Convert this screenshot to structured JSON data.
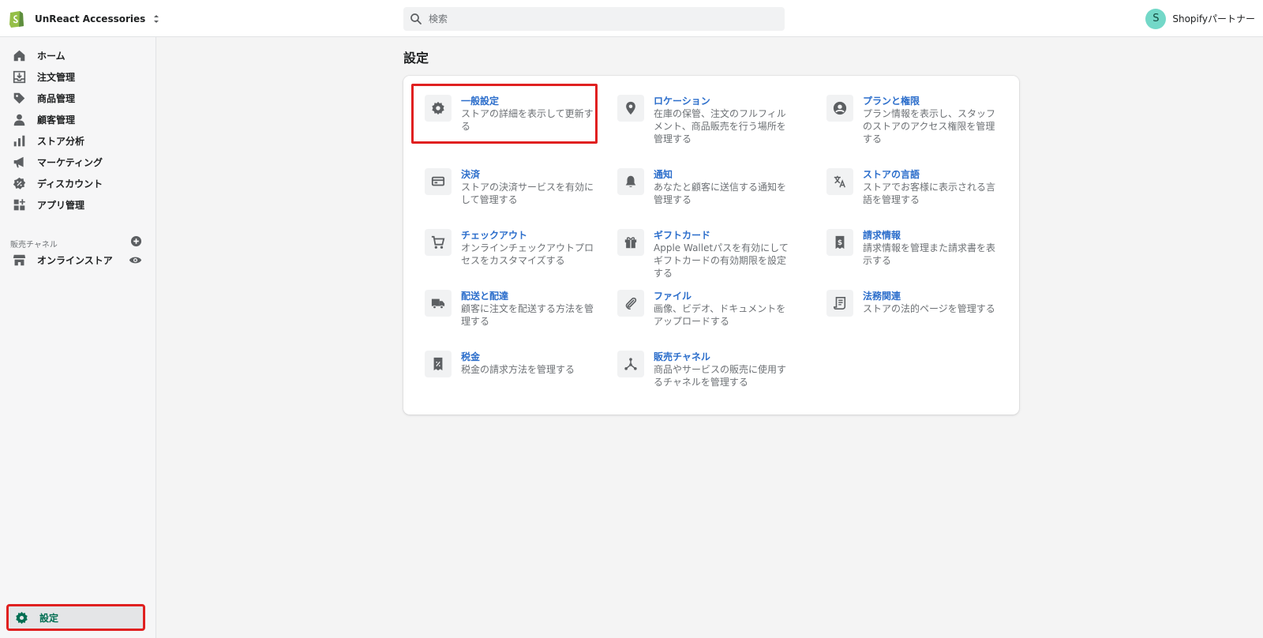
{
  "header": {
    "store_name": "UnReact Accessories",
    "search_placeholder": "検索",
    "user_initial": "S",
    "user_name": "Shopifyパートナー"
  },
  "sidebar": {
    "items": [
      {
        "label": "ホーム",
        "icon": "home-icon"
      },
      {
        "label": "注文管理",
        "icon": "orders-icon"
      },
      {
        "label": "商品管理",
        "icon": "tag-icon"
      },
      {
        "label": "顧客管理",
        "icon": "person-icon"
      },
      {
        "label": "ストア分析",
        "icon": "analytics-icon"
      },
      {
        "label": "マーケティング",
        "icon": "megaphone-icon"
      },
      {
        "label": "ディスカウント",
        "icon": "discount-icon"
      },
      {
        "label": "アプリ管理",
        "icon": "apps-icon"
      }
    ],
    "sales_channels_title": "販売チャネル",
    "online_store": "オンラインストア",
    "settings": "設定"
  },
  "main": {
    "title": "設定",
    "tiles": [
      {
        "title": "一般設定",
        "desc": "ストアの詳細を表示して更新する",
        "icon": "gear-icon"
      },
      {
        "title": "ロケーション",
        "desc": "在庫の保管、注文のフルフィルメント、商品販売を行う場所を管理する",
        "icon": "location-pin-icon"
      },
      {
        "title": "プランと権限",
        "desc": "プラン情報を表示し、スタッフのストアのアクセス権限を管理する",
        "icon": "user-circle-icon"
      },
      {
        "title": "決済",
        "desc": "ストアの決済サービスを有効にして管理する",
        "icon": "payment-card-icon"
      },
      {
        "title": "通知",
        "desc": "あなたと顧客に送信する通知を管理する",
        "icon": "bell-icon"
      },
      {
        "title": "ストアの言語",
        "desc": "ストアでお客様に表示される言語を管理する",
        "icon": "translate-icon"
      },
      {
        "title": "チェックアウト",
        "desc": "オンラインチェックアウトプロセスをカスタマイズする",
        "icon": "cart-icon"
      },
      {
        "title": "ギフトカード",
        "desc": "Apple Walletパスを有効にしてギフトカードの有効期限を設定する",
        "icon": "gift-icon"
      },
      {
        "title": "請求情報",
        "desc": "請求情報を管理また請求書を表示する",
        "icon": "billing-icon"
      },
      {
        "title": "配送と配達",
        "desc": "顧客に注文を配送する方法を管理する",
        "icon": "truck-icon"
      },
      {
        "title": "ファイル",
        "desc": "画像、ビデオ、ドキュメントをアップロードする",
        "icon": "paperclip-icon"
      },
      {
        "title": "法務関連",
        "desc": "ストアの法的ページを管理する",
        "icon": "legal-document-icon"
      },
      {
        "title": "税金",
        "desc": "税金の請求方法を管理する",
        "icon": "tax-receipt-icon"
      },
      {
        "title": "販売チャネル",
        "desc": "商品やサービスの販売に使用するチャネルを管理する",
        "icon": "channels-icon"
      }
    ]
  },
  "colors": {
    "link": "#2c6ecb",
    "active_nav": "#006e52",
    "highlight_box": "#e02020"
  }
}
